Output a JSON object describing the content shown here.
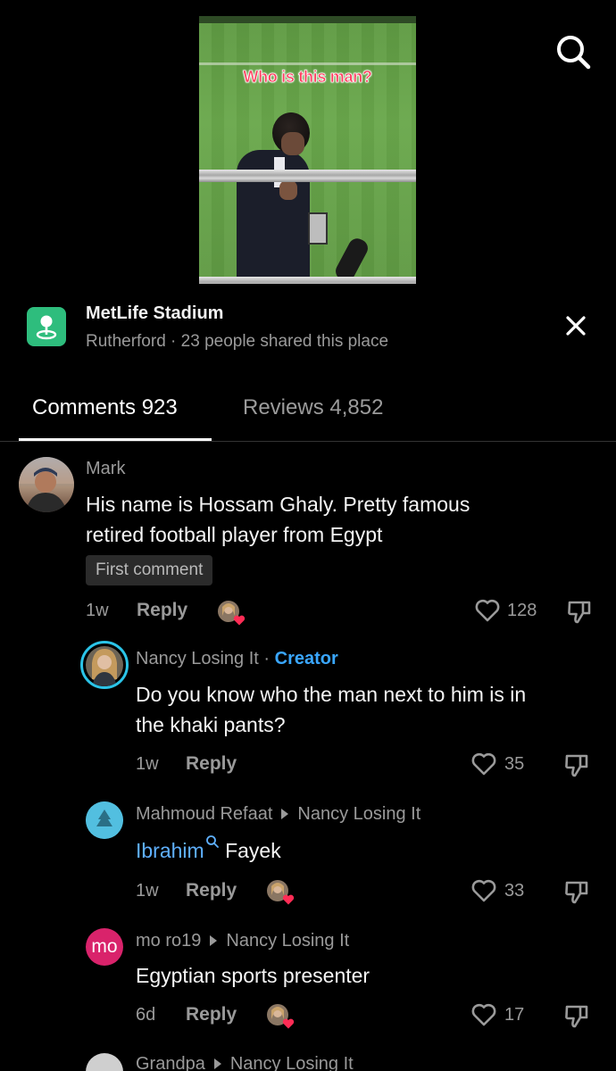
{
  "video": {
    "caption": "Who is this man?"
  },
  "location": {
    "name": "MetLife Stadium",
    "subtitle": "Rutherford · 23 people shared this place"
  },
  "tabs": [
    {
      "label": "Comments 923",
      "active": true
    },
    {
      "label": "Reviews 4,852",
      "active": false
    }
  ],
  "comments": [
    {
      "user": "Mark",
      "text_lines": [
        "His name is Hossam Ghaly. Pretty famous",
        "retired football player from Egypt"
      ],
      "badge": "First comment",
      "time": "1w",
      "reply": "Reply",
      "likes": "128"
    },
    {
      "user": "Nancy Losing It",
      "separator": "·",
      "tag": "Creator",
      "text_lines": [
        "Do you know who the man next to him is in",
        "the khaki pants?"
      ],
      "time": "1w",
      "reply": "Reply",
      "likes": "35"
    },
    {
      "user": "Mahmoud Refaat",
      "reply_to": "Nancy Losing It",
      "mention": "Ibrahim",
      "text_rest": "Fayek",
      "time": "1w",
      "reply": "Reply",
      "likes": "33"
    },
    {
      "user": "mo ro19",
      "avatar_initials": "mo",
      "reply_to": "Nancy Losing It",
      "text_lines": [
        "Egyptian sports presenter"
      ],
      "time": "6d",
      "reply": "Reply",
      "likes": "17"
    },
    {
      "user": "Grandpa",
      "reply_to": "Nancy Losing It"
    }
  ],
  "colors": {
    "accent_blue": "#3aa7ff",
    "place_green": "#2ebd7d",
    "like_red": "#fe2c55",
    "avatar_pink": "#d9236b"
  }
}
